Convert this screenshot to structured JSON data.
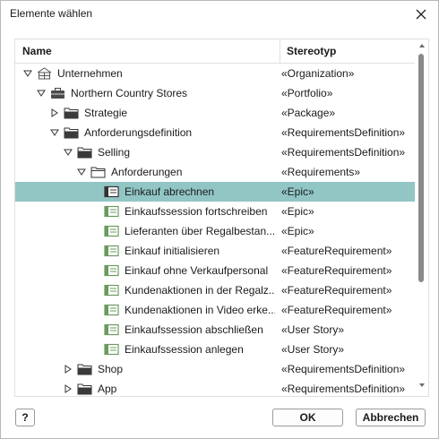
{
  "dialog": {
    "title": "Elemente wählen",
    "close_icon": "close-icon"
  },
  "columns": {
    "name": "Name",
    "stereotype": "Stereotyp"
  },
  "rows": [
    {
      "label": "Unternehmen",
      "stereotype": "«Organization»",
      "depth": 0,
      "expander": "expanded",
      "icon": "organization-icon"
    },
    {
      "label": "Northern Country Stores",
      "stereotype": "«Portfolio»",
      "depth": 1,
      "expander": "expanded",
      "icon": "briefcase-icon"
    },
    {
      "label": "Strategie",
      "stereotype": "«Package»",
      "depth": 2,
      "expander": "collapsed",
      "icon": "package-icon"
    },
    {
      "label": "Anforderungsdefinition",
      "stereotype": "«RequirementsDefinition»",
      "depth": 2,
      "expander": "expanded",
      "icon": "package-icon"
    },
    {
      "label": "Selling",
      "stereotype": "«RequirementsDefinition»",
      "depth": 3,
      "expander": "expanded",
      "icon": "package-icon"
    },
    {
      "label": "Anforderungen",
      "stereotype": "«Requirements»",
      "depth": 4,
      "expander": "expanded",
      "icon": "package-outline-icon"
    },
    {
      "label": "Einkauf abrechnen",
      "stereotype": "«Epic»",
      "depth": 5,
      "expander": "none",
      "icon": "requirement-icon",
      "selected": true
    },
    {
      "label": "Einkaufssession fortschreiben",
      "stereotype": "«Epic»",
      "depth": 5,
      "expander": "none",
      "icon": "requirement-icon"
    },
    {
      "label": "Lieferanten über Regalbestan...",
      "stereotype": "«Epic»",
      "depth": 5,
      "expander": "none",
      "icon": "requirement-icon"
    },
    {
      "label": "Einkauf initialisieren",
      "stereotype": "«FeatureRequirement»",
      "depth": 5,
      "expander": "none",
      "icon": "requirement-icon"
    },
    {
      "label": "Einkauf ohne Verkaufpersonal",
      "stereotype": "«FeatureRequirement»",
      "depth": 5,
      "expander": "none",
      "icon": "requirement-icon"
    },
    {
      "label": "Kundenaktionen in der Regalz...",
      "stereotype": "«FeatureRequirement»",
      "depth": 5,
      "expander": "none",
      "icon": "requirement-icon"
    },
    {
      "label": "Kundenaktionen in Video erke...",
      "stereotype": "«FeatureRequirement»",
      "depth": 5,
      "expander": "none",
      "icon": "requirement-icon"
    },
    {
      "label": "Einkaufssession abschließen",
      "stereotype": "«User Story»",
      "depth": 5,
      "expander": "none",
      "icon": "requirement-icon"
    },
    {
      "label": "Einkaufssession anlegen",
      "stereotype": "«User Story»",
      "depth": 5,
      "expander": "none",
      "icon": "requirement-icon"
    },
    {
      "label": "Shop",
      "stereotype": "«RequirementsDefinition»",
      "depth": 3,
      "expander": "collapsed",
      "icon": "package-icon"
    },
    {
      "label": "App",
      "stereotype": "«RequirementsDefinition»",
      "depth": 3,
      "expander": "collapsed",
      "icon": "package-icon"
    }
  ],
  "buttons": {
    "help": "?",
    "ok": "OK",
    "cancel": "Abbrechen"
  },
  "colors": {
    "selection": "#91c6c5",
    "requirement_icon": "#6a9b5d",
    "scroll_thumb": "#8a8a8a"
  }
}
